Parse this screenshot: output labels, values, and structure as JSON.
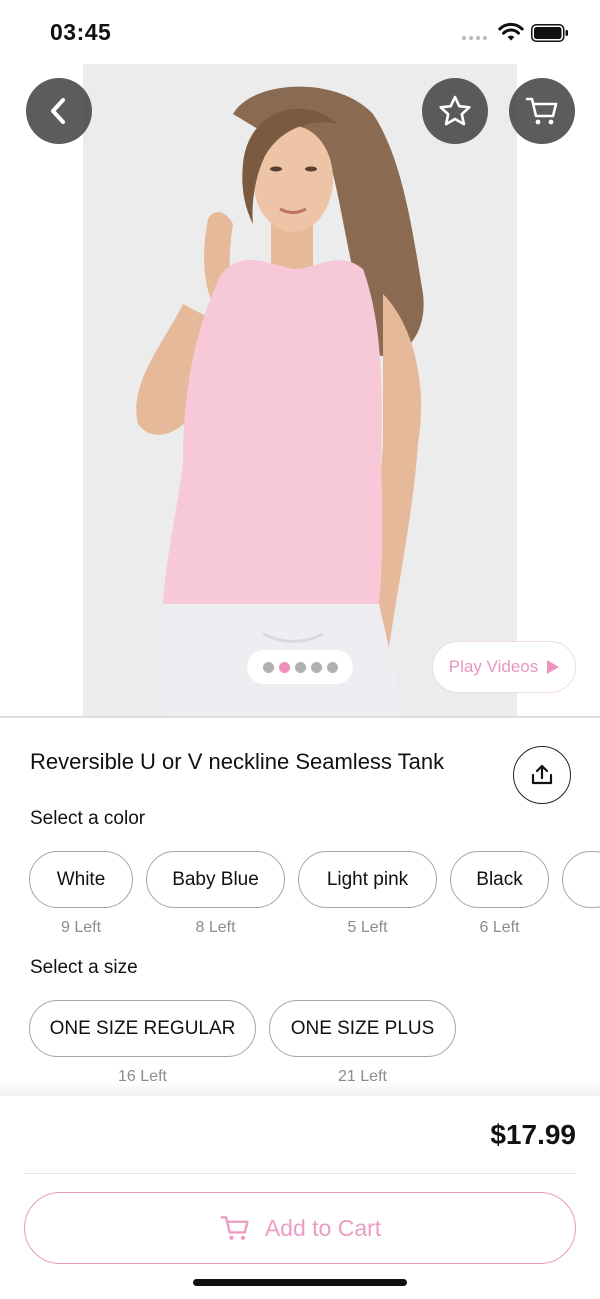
{
  "status_bar": {
    "time": "03:45"
  },
  "hero": {
    "image_alt": "Model wearing light pink seamless tank top",
    "pager": {
      "count": 5,
      "active_index": 1
    },
    "play_videos_label": "Play Videos"
  },
  "product": {
    "title": "Reversible U or V neckline Seamless Tank"
  },
  "colors": {
    "label": "Select a color",
    "options": [
      {
        "name": "White",
        "stock": "9 Left"
      },
      {
        "name": "Baby Blue",
        "stock": "8 Left"
      },
      {
        "name": "Light pink",
        "stock": "5 Left"
      },
      {
        "name": "Black",
        "stock": "6 Left"
      }
    ]
  },
  "sizes": {
    "label": "Select a size",
    "options": [
      {
        "name": "ONE SIZE REGULAR",
        "stock": "16 Left"
      },
      {
        "name": "ONE SIZE PLUS",
        "stock": "21 Left"
      }
    ]
  },
  "purchase": {
    "price": "$17.99",
    "add_to_cart_label": "Add to Cart"
  },
  "theme": {
    "accent_pink": "#ea94bf",
    "button_dark": "#464646",
    "chip_border": "#a7a7a7"
  }
}
